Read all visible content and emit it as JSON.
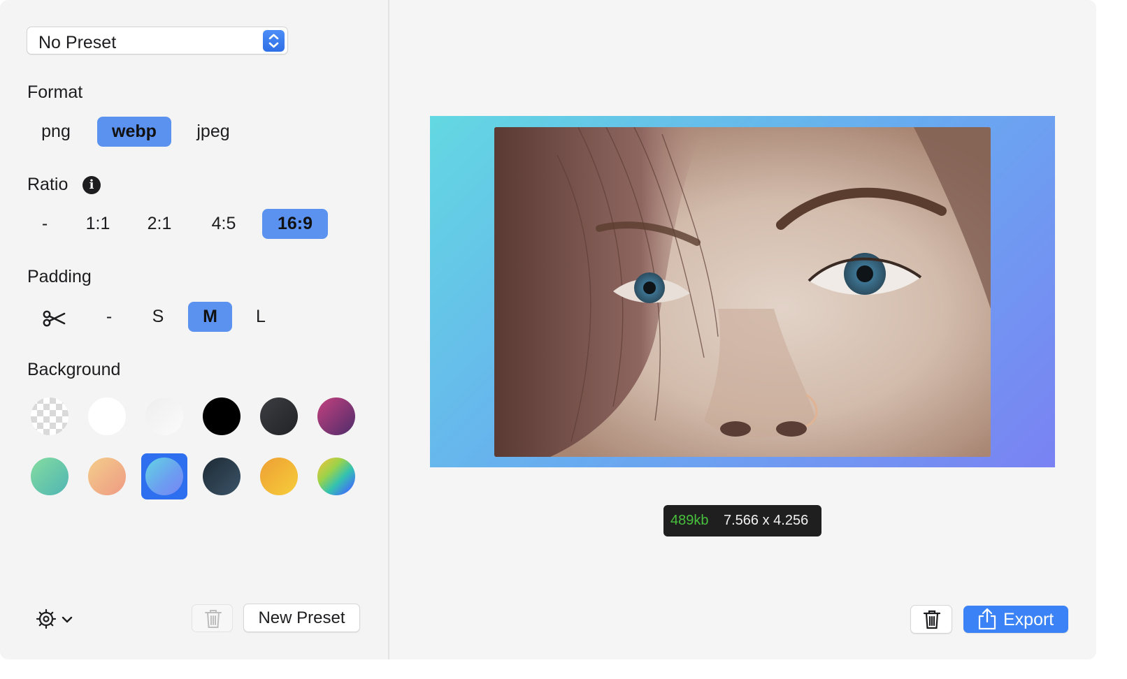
{
  "preset": {
    "selected": "No Preset"
  },
  "format": {
    "label": "Format",
    "options": [
      "png",
      "webp",
      "jpeg"
    ],
    "selected": "webp"
  },
  "ratio": {
    "label": "Ratio",
    "info_glyph": "i",
    "options": [
      "-",
      "1:1",
      "2:1",
      "4:5",
      "16:9"
    ],
    "selected": "16:9"
  },
  "padding": {
    "label": "Padding",
    "options": [
      "crop-icon",
      "-",
      "S",
      "M",
      "L"
    ],
    "selected": "M"
  },
  "background": {
    "label": "Background",
    "swatches": [
      "transparent-checker",
      "white",
      "light-gray-gradient",
      "black",
      "dark-gray",
      "magenta-purple-gradient",
      "green-teal-gradient",
      "peach-gradient",
      "blue-gradient",
      "dark-slate-gradient",
      "orange-yellow-gradient",
      "rainbow-gradient"
    ],
    "selected": "blue-gradient"
  },
  "footer": {
    "new_preset_label": "New Preset"
  },
  "preview": {
    "file_size": "489kb",
    "dimensions": "7.566 x 4.256",
    "background_colors": [
      "#63d8e2",
      "#68abf0",
      "#7a82f3"
    ]
  },
  "toolbar": {
    "export_label": "Export"
  },
  "colors": {
    "accent": "#3a82f5",
    "selected_segment": "#5b92f0",
    "file_size_green": "#48c03d"
  }
}
